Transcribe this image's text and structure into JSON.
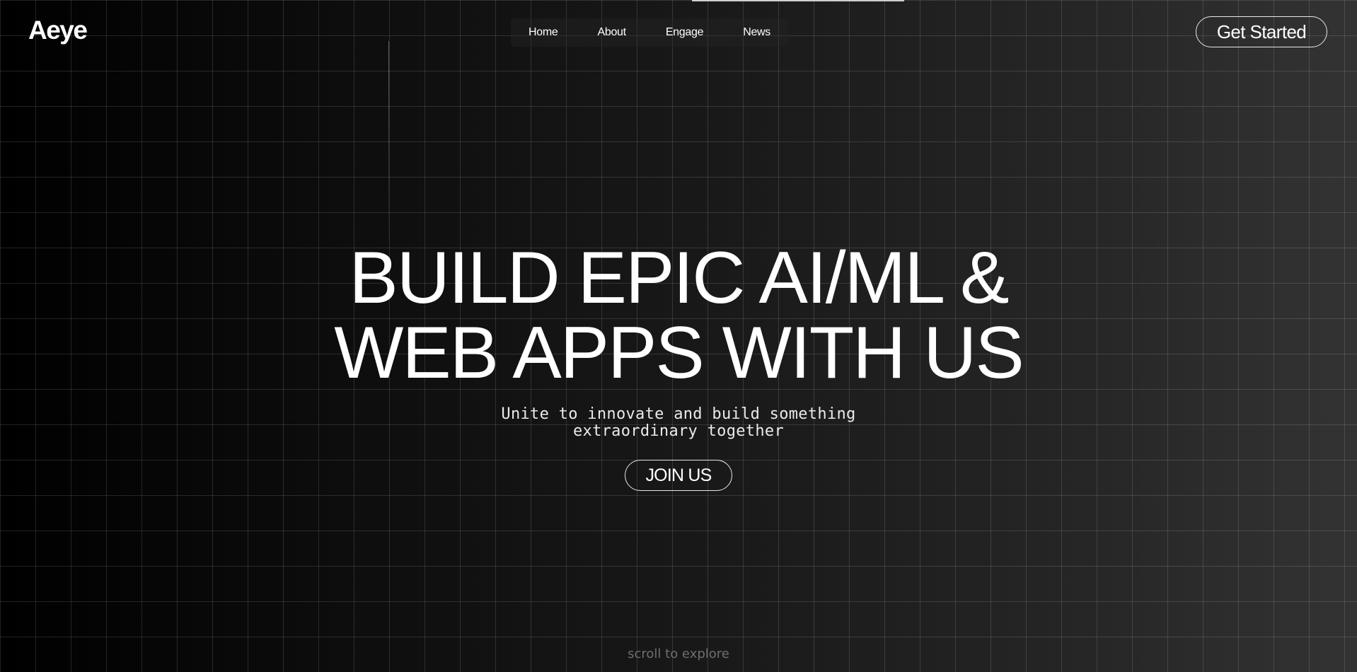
{
  "brand": {
    "logo_text": "Aeye"
  },
  "nav": {
    "items": [
      {
        "label": "Home"
      },
      {
        "label": "About"
      },
      {
        "label": "Engage"
      },
      {
        "label": "News"
      }
    ]
  },
  "header": {
    "cta_label": "Get Started"
  },
  "hero": {
    "headline_line1": "BUILD EPIC AI/ML &",
    "headline_line2": "WEB APPS WITH US",
    "subtitle": "Unite to innovate and build something extraordinary together",
    "join_label": "JOIN US"
  },
  "footer": {
    "scroll_hint": "scroll to explore"
  },
  "colors": {
    "background_dark": "#000000",
    "background_light": "#333333",
    "text": "#ffffff",
    "muted_text": "#6e6e6e"
  }
}
